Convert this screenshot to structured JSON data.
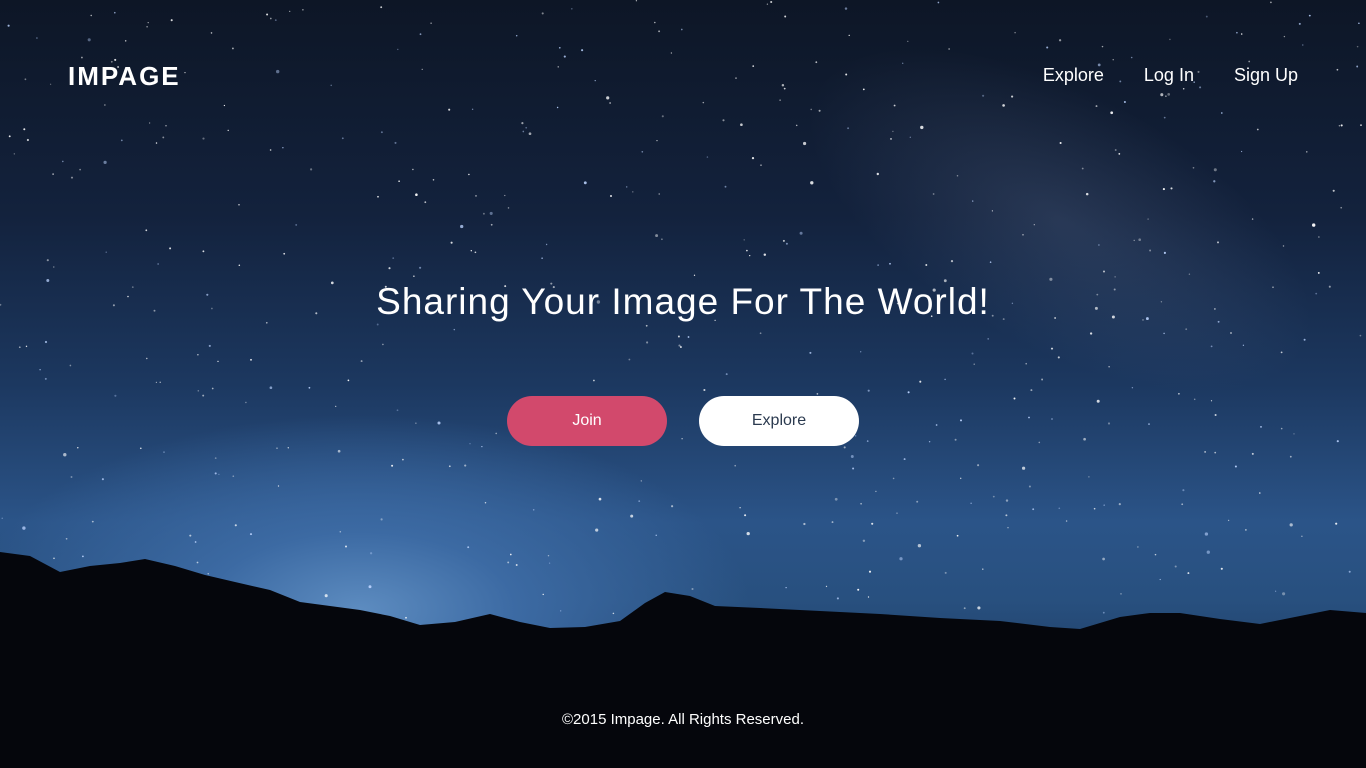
{
  "brand": {
    "logo": "IMPAGE"
  },
  "nav": {
    "items": [
      {
        "label": "Explore"
      },
      {
        "label": "Log In"
      },
      {
        "label": "Sign Up"
      }
    ]
  },
  "hero": {
    "headline": "Sharing Your Image For The World!",
    "join_label": "Join",
    "explore_label": "Explore"
  },
  "footer": {
    "copyright": "©2015 Impage. All Rights Reserved."
  },
  "colors": {
    "join_button": "#d2496c",
    "explore_button": "#ffffff",
    "text": "#ffffff"
  }
}
